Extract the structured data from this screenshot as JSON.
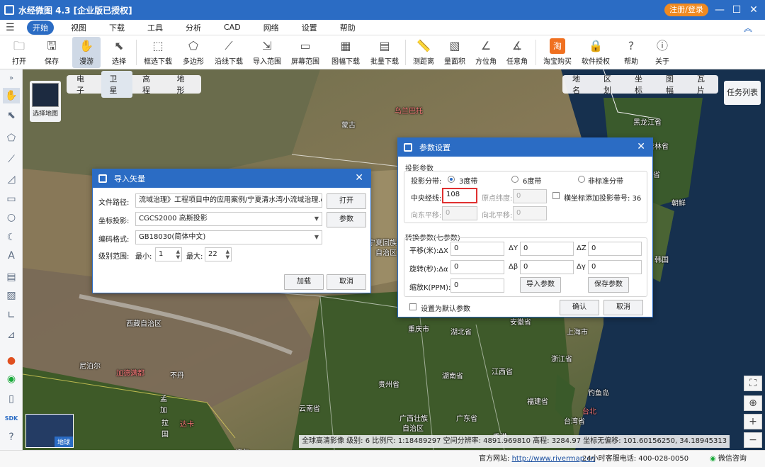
{
  "app": {
    "title": "水经微图 4.3 [企业版已授权]",
    "register": "注册/登录"
  },
  "menu": [
    "开始",
    "视图",
    "下载",
    "工具",
    "分析",
    "CAD",
    "网络",
    "设置",
    "帮助"
  ],
  "toolbar": [
    "打开",
    "保存",
    "漫游",
    "选择",
    "框选下载",
    "多边形",
    "沿线下载",
    "导入范围",
    "屏幕范围",
    "图幅下载",
    "批量下载",
    "测距离",
    "量面积",
    "方位角",
    "任意角",
    "淘宝购买",
    "软件授权",
    "帮助",
    "关于"
  ],
  "maptypes": [
    "电子",
    "卫星",
    "高程",
    "地形"
  ],
  "overlays": [
    "地名",
    "区划",
    "坐标",
    "图幅",
    "瓦片"
  ],
  "mapselect": "选择地图",
  "tasklist": "任务列表",
  "globe": "地球",
  "labels": [
    [
      "蒙古",
      450,
      70,
      0
    ],
    [
      "乌兰巴托",
      525,
      50,
      1
    ],
    [
      "黑龙江省",
      862,
      66,
      0
    ],
    [
      "吉林省",
      882,
      100,
      0
    ],
    [
      "辽宁省",
      870,
      140,
      0
    ],
    [
      "朝鲜",
      916,
      180,
      0
    ],
    [
      "韩国",
      892,
      260,
      0
    ],
    [
      "宁夏回族",
      488,
      236,
      0
    ],
    [
      "自治区",
      498,
      250,
      0
    ],
    [
      "西藏自治区",
      146,
      350,
      0
    ],
    [
      "尼泊尔",
      80,
      410,
      0
    ],
    [
      "加德满都",
      132,
      420,
      1
    ],
    [
      "不丹",
      208,
      423,
      0
    ],
    [
      "孟",
      194,
      456,
      0
    ],
    [
      "加",
      194,
      472,
      0
    ],
    [
      "拉",
      196,
      490,
      0
    ],
    [
      "国",
      196,
      506,
      0
    ],
    [
      "达卡",
      222,
      492,
      1
    ],
    [
      "缅甸",
      300,
      532,
      0
    ],
    [
      "重庆市",
      544,
      358,
      0
    ],
    [
      "湖北省",
      604,
      362,
      0
    ],
    [
      "安徽省",
      688,
      348,
      0
    ],
    [
      "上海市",
      768,
      362,
      0
    ],
    [
      "贵州省",
      502,
      436,
      0
    ],
    [
      "湖南省",
      592,
      424,
      0
    ],
    [
      "江西省",
      662,
      418,
      0
    ],
    [
      "浙江省",
      746,
      400,
      0
    ],
    [
      "云南省",
      390,
      470,
      0
    ],
    [
      "广西壮族",
      532,
      484,
      0
    ],
    [
      "自治区",
      536,
      498,
      0
    ],
    [
      "广东省",
      612,
      484,
      0
    ],
    [
      "福建省",
      712,
      460,
      0
    ],
    [
      "台湾省",
      764,
      488,
      0
    ],
    [
      "钓鱼岛",
      798,
      448,
      0
    ],
    [
      "台北",
      790,
      474,
      1
    ],
    [
      "香港",
      664,
      510,
      0
    ]
  ],
  "statusbar": "全球高清影像  级别: 6 比例尺: 1:18489297   空间分辨率: 4891.969810   高程: 3284.97   坐标无偏移: 101.60156250, 34.18945313",
  "footer": {
    "site_label": "官方网站:",
    "site": "http://www.rivermap.cn",
    "service": "24小时客服电话: 400-028-0050",
    "wechat": "微信咨询"
  },
  "import": {
    "title": "导入矢量",
    "file_label": "文件路径:",
    "file_value": "流域治理》工程项目中的应用案例/宁夏清水湾小流域治理.dxf;",
    "open": "打开",
    "proj_label": "坐标投影:",
    "proj_value": "CGCS2000 高斯投影",
    "param": "参数",
    "enc_label": "编码格式:",
    "enc_value": "GB18030(简体中文)",
    "level_label": "级别范围:",
    "min_label": "最小:",
    "min_value": "1",
    "max_label": "最大:",
    "max_value": "22",
    "load": "加载",
    "cancel": "取消"
  },
  "param": {
    "title": "参数设置",
    "proj_group": "投影参数",
    "band_label": "投影分带:",
    "band3": "3度带",
    "band6": "6度带",
    "bandn": "非标准分带",
    "cm_label": "中央经线:",
    "cm_value": "108",
    "lat_label": "原点纬度:",
    "lat_value": "0",
    "addband_label": "横坐标添加投影带号: 36",
    "east_label": "向东平移:",
    "east_value": "0",
    "north_label": "向北平移:",
    "north_value": "0",
    "trans_group": "转换参数(七参数)",
    "dx_label": "平移(米):ΔX",
    "dx": "0",
    "dy_label": "ΔY",
    "dy": "0",
    "dz_label": "ΔZ",
    "dz": "0",
    "ra_label": "旋转(秒):Δα",
    "ra": "0",
    "rb_label": "Δβ",
    "rb": "0",
    "rg_label": "Δγ",
    "rg": "0",
    "k_label": "缩放K(PPM):",
    "k": "0",
    "import": "导入参数",
    "save": "保存参数",
    "default_label": "设置为默认参数",
    "ok": "确认",
    "cancel": "取消"
  },
  "colors": {
    "accent": "#2b6cc4",
    "highlight": "#e03030",
    "register": "#f08a20"
  }
}
